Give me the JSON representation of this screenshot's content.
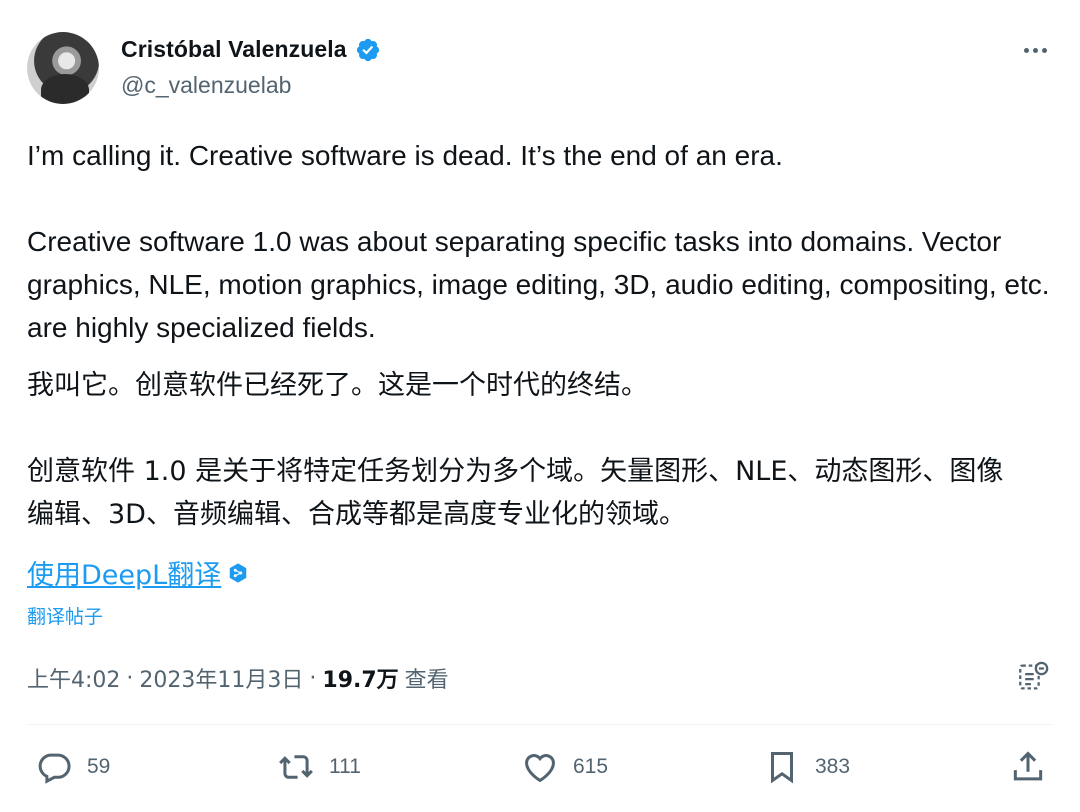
{
  "author": {
    "display_name": "Cristóbal Valenzuela",
    "handle": "@c_valenzuelab"
  },
  "tweet": {
    "line1": "I’m calling it. Creative software is dead. It’s the end of an era.",
    "para2": "Creative software 1.0 was about separating specific tasks into domains. Vector graphics, NLE, motion graphics, image editing, 3D, audio editing, compositing, etc. are highly specialized fields.",
    "zh_line1": "我叫它。创意软件已经死了。这是一个时代的终结。",
    "zh_para2": "创意软件 1.0 是关于将特定任务划分为多个域。矢量图形、NLE、动态图形、图像编辑、3D、音频编辑、合成等都是高度专业化的领域。"
  },
  "translation": {
    "deepl_link": "使用DeepL翻译",
    "translate_post": "翻译帖子"
  },
  "meta": {
    "time": "上午4:02",
    "separator": "·",
    "date": "2023年11月3日",
    "views_count": "19.7万",
    "views_label": "查看"
  },
  "actions": {
    "replies": "59",
    "reposts": "111",
    "likes": "615",
    "bookmarks": "383"
  },
  "icons": {
    "verified": "verified-badge-icon",
    "more": "more-icon",
    "deepl": "deepl-badge-icon",
    "analytics": "analytics-icon",
    "reply": "reply-icon",
    "repost": "repost-icon",
    "like": "heart-icon",
    "bookmark": "bookmark-icon",
    "share": "share-icon"
  },
  "colors": {
    "accent": "#1d9bf0",
    "text": "#0f1419",
    "secondary": "#536471"
  }
}
